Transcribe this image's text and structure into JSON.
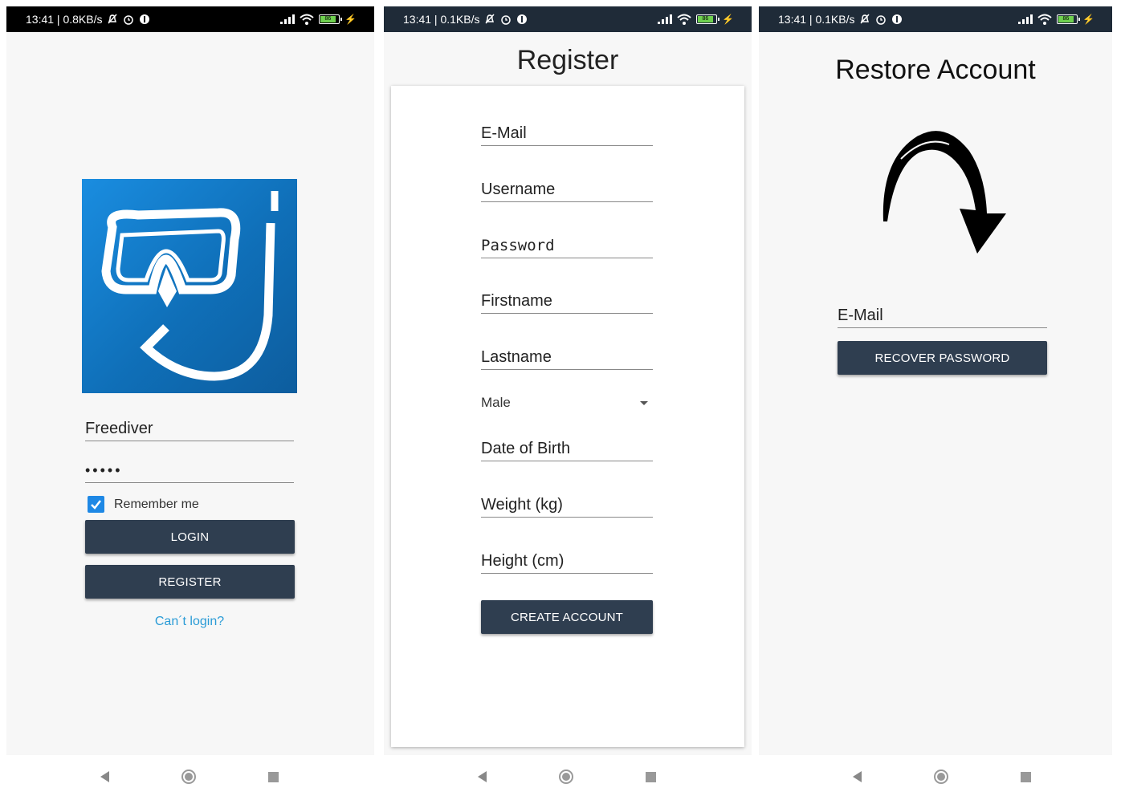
{
  "statusbars": [
    {
      "time": "13:41 | 0.8KB/s"
    },
    {
      "time": "13:41 | 0.1KB/s"
    },
    {
      "time": "13:41 | 0.1KB/s"
    }
  ],
  "battery_level": "86",
  "login": {
    "username_value": "Freediver",
    "password_value": "•••••",
    "remember_label": "Remember me",
    "remember_checked": true,
    "login_button": "LOGIN",
    "register_button": "REGISTER",
    "cant_login_link": "Can´t login?"
  },
  "register": {
    "title": "Register",
    "fields": [
      "E-Mail",
      "Username",
      "Password",
      "Firstname",
      "Lastname"
    ],
    "gender_value": "Male",
    "fields2": [
      "Date of Birth",
      "Weight (kg)",
      "Height (cm)"
    ],
    "create_button": "CREATE ACCOUNT"
  },
  "restore": {
    "title": "Restore Account",
    "email_placeholder": "E-Mail",
    "recover_button": "RECOVER PASSWORD"
  },
  "icons": [
    "back-icon",
    "home-icon",
    "recents-icon",
    "signal-icon",
    "wifi-icon",
    "battery-icon",
    "alarm-icon",
    "mute-icon",
    "snorkel-mask-logo",
    "curved-arrow-icon"
  ],
  "colors": {
    "primary_button": "#2f3e50",
    "link": "#2a9bd6",
    "checkbox": "#1e88e5",
    "logo_blue": "#1a8de0"
  }
}
